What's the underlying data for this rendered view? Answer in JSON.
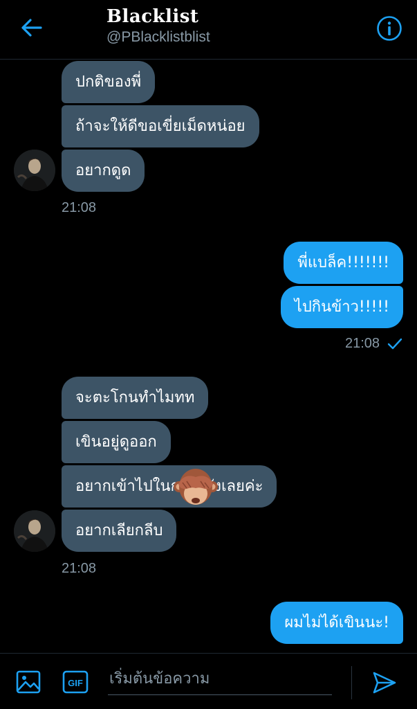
{
  "header": {
    "title": "Blacklist",
    "handle": "@PBlacklistblist"
  },
  "messages": {
    "group1": [
      "ปกติของพี่",
      "ถ้าจะให้ดีขอเขี่ยเม็ดหน่อย",
      "อยากดูด"
    ],
    "group1_time": "21:08",
    "group2": [
      "พี่แบล็ค!!!!!!!",
      "ไปกินข้าว!!!!!"
    ],
    "group2_time": "21:08",
    "group3": [
      "จะตะโกนทำไมทท",
      "เขินอยู่ดูออก",
      "อยากเข้าไปในกลางจังเลยค่ะ",
      "อยากเลียกลีบ"
    ],
    "group3_time": "21:08",
    "group4": [
      "ผมไม่ได้เขินนะ!"
    ]
  },
  "composer": {
    "placeholder": "เริ่มต้นข้อความ",
    "gif_label": "GIF"
  },
  "colors": {
    "accent": "#1da1f2",
    "incoming_bubble": "#3d5466",
    "background": "#000000",
    "muted": "#8899a6"
  },
  "icons": {
    "back": "arrow-left-icon",
    "info": "info-circle-icon",
    "image": "image-icon",
    "gif": "gif-icon",
    "send": "send-icon",
    "read": "checkmark-icon",
    "emoji": "see-no-evil-monkey-emoji"
  }
}
